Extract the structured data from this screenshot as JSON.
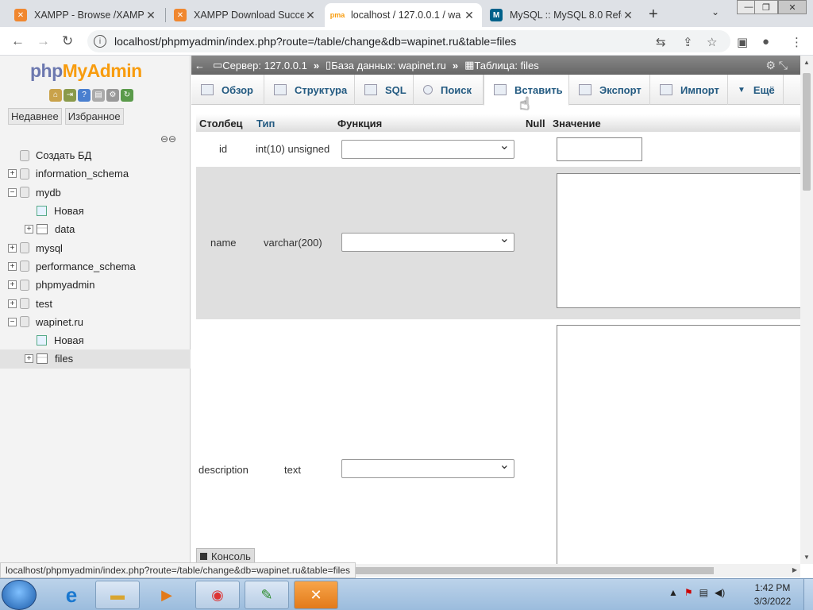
{
  "browser": {
    "tabs": [
      {
        "title": "XAMPP - Browse /XAMPP",
        "favicon": "xampp-icon",
        "color": "#f0872f"
      },
      {
        "title": "XAMPP Download Succe",
        "favicon": "xampp-icon",
        "color": "#f0872f"
      },
      {
        "title": "localhost / 127.0.0.1 / wa",
        "favicon": "phpmyadmin-icon",
        "color": "#f89c0e"
      },
      {
        "title": "MySQL :: MySQL 8.0 Refe",
        "favicon": "mysql-icon",
        "color": "#00618a"
      }
    ],
    "url": "localhost/phpmyadmin/index.php?route=/table/change&db=wapinet.ru&table=files",
    "status_url": "localhost/phpmyadmin/index.php?route=/table/change&db=wapinet.ru&table=files"
  },
  "sidebar": {
    "logo_php": "php",
    "logo_myadmin": "MyAdmin",
    "recent_label": "Недавнее",
    "favorites_label": "Избранное",
    "tree": [
      {
        "label": "Создать БД",
        "level": 0,
        "expander": "",
        "icon": "db"
      },
      {
        "label": "information_schema",
        "level": 0,
        "expander": "+",
        "icon": "db"
      },
      {
        "label": "mydb",
        "level": 0,
        "expander": "−",
        "icon": "db"
      },
      {
        "label": "Новая",
        "level": 1,
        "expander": "",
        "icon": "new"
      },
      {
        "label": "data",
        "level": 1,
        "expander": "+",
        "icon": "table"
      },
      {
        "label": "mysql",
        "level": 0,
        "expander": "+",
        "icon": "db"
      },
      {
        "label": "performance_schema",
        "level": 0,
        "expander": "+",
        "icon": "db"
      },
      {
        "label": "phpmyadmin",
        "level": 0,
        "expander": "+",
        "icon": "db"
      },
      {
        "label": "test",
        "level": 0,
        "expander": "+",
        "icon": "db"
      },
      {
        "label": "wapinet.ru",
        "level": 0,
        "expander": "−",
        "icon": "db"
      },
      {
        "label": "Новая",
        "level": 1,
        "expander": "",
        "icon": "new"
      },
      {
        "label": "files",
        "level": 1,
        "expander": "+",
        "icon": "table",
        "selected": true
      }
    ]
  },
  "breadcrumb": {
    "server": "Сервер: 127.0.0.1",
    "database": "База данных: wapinet.ru",
    "table": "Таблица: files"
  },
  "tabs": {
    "browse": "Обзор",
    "structure": "Структура",
    "sql": "SQL",
    "search": "Поиск",
    "insert": "Вставить",
    "export": "Экспорт",
    "import": "Импорт",
    "more": "Ещё"
  },
  "form": {
    "headers": {
      "column": "Столбец",
      "type": "Тип",
      "function": "Функция",
      "null": "Null",
      "value": "Значение"
    },
    "rows": [
      {
        "column": "id",
        "type": "int(10) unsigned"
      },
      {
        "column": "name",
        "type": "varchar(200)"
      },
      {
        "column": "description",
        "type": "text"
      }
    ]
  },
  "console_label": "Консоль",
  "taskbar": {
    "time": "1:42 PM",
    "date": "3/3/2022"
  }
}
